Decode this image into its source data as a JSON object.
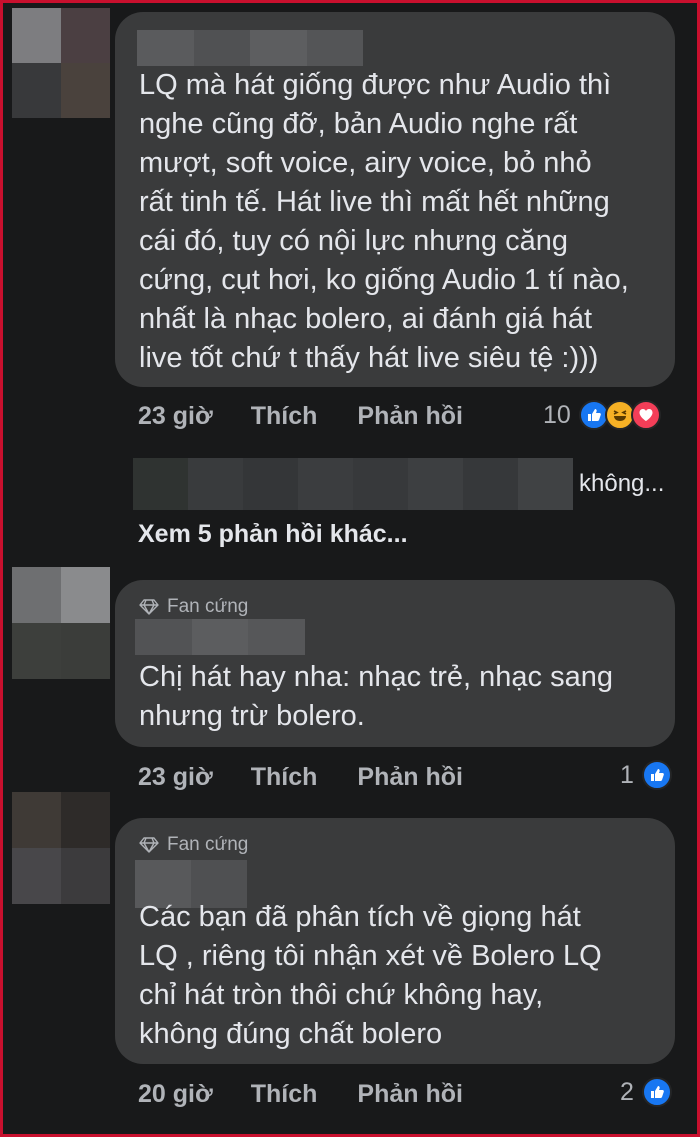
{
  "comments": [
    {
      "text": "LQ mà hát giống được như Audio thì\nnghe cũng đỡ, bản Audio nghe rất\nmượt, soft voice, airy voice, bỏ nhỏ\nrất tinh tế. Hát live thì mất hết những\ncái đó, tuy có nội lực nhưng căng\ncứng, cụt hơi, ko giống Audio 1 tí nào,\nnhất là nhạc bolero, ai đánh giá hát\nlive tốt chứ t thấy hát live siêu tệ :)))",
      "time": "23 giờ",
      "like_label": "Thích",
      "reply_label": "Phản hồi",
      "reaction_count": "10",
      "reactions": [
        "like-icon",
        "haha-icon",
        "love-icon"
      ]
    },
    {
      "badge": "Fan cứng",
      "text": "Chị hát hay nha: nhạc trẻ, nhạc sang\nnhưng trừ bolero.",
      "time": "23 giờ",
      "like_label": "Thích",
      "reply_label": "Phản hồi",
      "reaction_count": "1",
      "reactions": [
        "like-icon"
      ]
    },
    {
      "badge": "Fan cứng",
      "text": "Các bạn đã phân tích về giọng hát\nLQ , riêng tôi nhận xét   về Bolero LQ\nchỉ hát tròn thôi chứ không hay,\nkhông đúng chất bolero",
      "time": "20 giờ",
      "like_label": "Thích",
      "reply_label": "Phản hồi",
      "reaction_count": "2",
      "reactions": [
        "like-icon"
      ]
    }
  ],
  "reply_preview": {
    "tail": "không..."
  },
  "more_replies": "Xem 5 phản hồi khác...",
  "colors": {
    "background": "#18191a",
    "bubble": "#3a3b3c",
    "like": "#1877f2",
    "haha": "#f7b125",
    "love": "#f33e58",
    "frame": "#c8102e"
  }
}
